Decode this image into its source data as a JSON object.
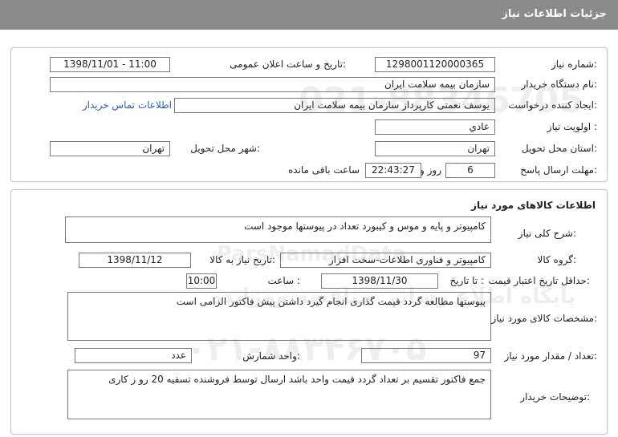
{
  "page": {
    "title": "جزئیات اطلاعات نیاز"
  },
  "need": {
    "need_number_label": "شماره نیاز:",
    "need_number": "1298001120000365",
    "announce_label": "تاریخ و ساعت اعلان عمومی:",
    "announce_value": "1398/11/01 - 11:00",
    "buyer_org_label": "نام دستگاه خریدار:",
    "buyer_org": "سازمان بیمه سلامت ایران",
    "creator_label": "ایجاد کننده درخواست:",
    "creator": "یوسف نعمتی کارپرداز سازمان بیمه سلامت ایران",
    "contact_link": "اطلاعات تماس خریدار",
    "priority_label": "اولویت نیاز :",
    "priority": "عادي",
    "province_label": "استان محل تحویل:",
    "province": "تهران",
    "city_label": "شهر محل تحویل:",
    "city": "تهران",
    "deadline_label": "مهلت ارسال پاسخ:",
    "days": "6",
    "days_and": "روز و",
    "time_left": "22:43:27",
    "remaining_label": "ساعت باقی مانده"
  },
  "goods": {
    "section_title": "اطلاعات کالاهای مورد نیاز",
    "desc_label": "شرح کلی نیاز:",
    "desc": "کامپیوتر و پایه و موس و کیبورد تعداد در پیوستها موجود است",
    "group_label": "گروه کالا:",
    "group": "کامپیوتر و فناوری اطلاعات-سخت افزار",
    "need_date_label": "تاریخ نیاز به کالا:",
    "need_date": "1398/11/12",
    "validity_label": "حداقل تاریخ اعتبار قیمت:",
    "until_date_label": "تا تاریخ :",
    "until_date": "1398/11/30",
    "hour_label": "ساعت :",
    "hour": "10:00",
    "specs_label": "مشخصات کالای مورد نیاز:",
    "specs": "پیوستها مطالعه گردد  قیمت گذاری انجام گیرد داشتن پیش فاکتور الزامی است",
    "qty_label": "تعداد / مقدار مورد نیاز:",
    "qty": "97",
    "unit_label": "واحد شمارش:",
    "unit": "عدد",
    "buyer_notes_label": "توضیحات خریدار:",
    "buyer_notes": "جمع فاکتور تقسیم بر تعداد گردد قیمت واحد باشد ارسال توسط فروشنده تسفیه 20 رو ز کاری"
  },
  "watermark": {
    "line1": "ParsNamadData",
    "line2": "پایگاه اطلاع رسانی مناقصه ومزایده",
    "line3": "۰۲۱-۸۸۳۴۶۷۰۵",
    "digits": "021-88346705"
  }
}
